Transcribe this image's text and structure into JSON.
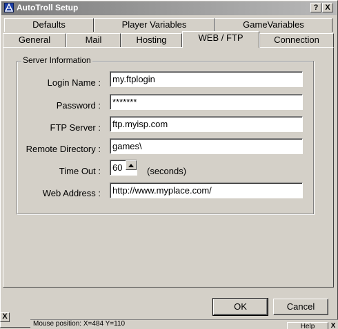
{
  "window": {
    "title": "AutoTroll Setup",
    "help_button": "?",
    "close_button": "X"
  },
  "tabs": {
    "row_back": [
      {
        "label": "Defaults"
      },
      {
        "label": "Player Variables"
      },
      {
        "label": "GameVariables"
      }
    ],
    "row_front": [
      {
        "label": "General"
      },
      {
        "label": "Mail"
      },
      {
        "label": "Hosting"
      },
      {
        "label": "WEB / FTP",
        "active": true
      },
      {
        "label": "Connection"
      }
    ]
  },
  "server_info": {
    "group_label": "Server Information",
    "login_name": {
      "label": "Login Name :",
      "value": "my.ftplogin"
    },
    "password": {
      "label": "Password :",
      "value": "*******"
    },
    "ftp_server": {
      "label": "FTP Server :",
      "value": "ftp.myisp.com"
    },
    "remote_directory": {
      "label": "Remote Directory :",
      "value": "games\\"
    },
    "time_out": {
      "label": "Time Out :",
      "value": "60",
      "unit": "(seconds)"
    },
    "web_address": {
      "label": "Web Address :",
      "value": "http://www.myplace.com/"
    }
  },
  "buttons": {
    "ok": "OK",
    "cancel": "Cancel"
  },
  "overlay": {
    "close_glyph": "X",
    "status_text": "Mouse position:   X=484   Y=110",
    "help_label": "Help",
    "help_close": "X"
  },
  "colors": {
    "face": "#d4d0c8",
    "titlebar_start": "#7d7d7d",
    "titlebar_end": "#b9b9b9",
    "field_bg": "#ffffff"
  },
  "icons": {
    "app": "autotroll-app-icon",
    "spin_up": "triangle-up-icon"
  }
}
